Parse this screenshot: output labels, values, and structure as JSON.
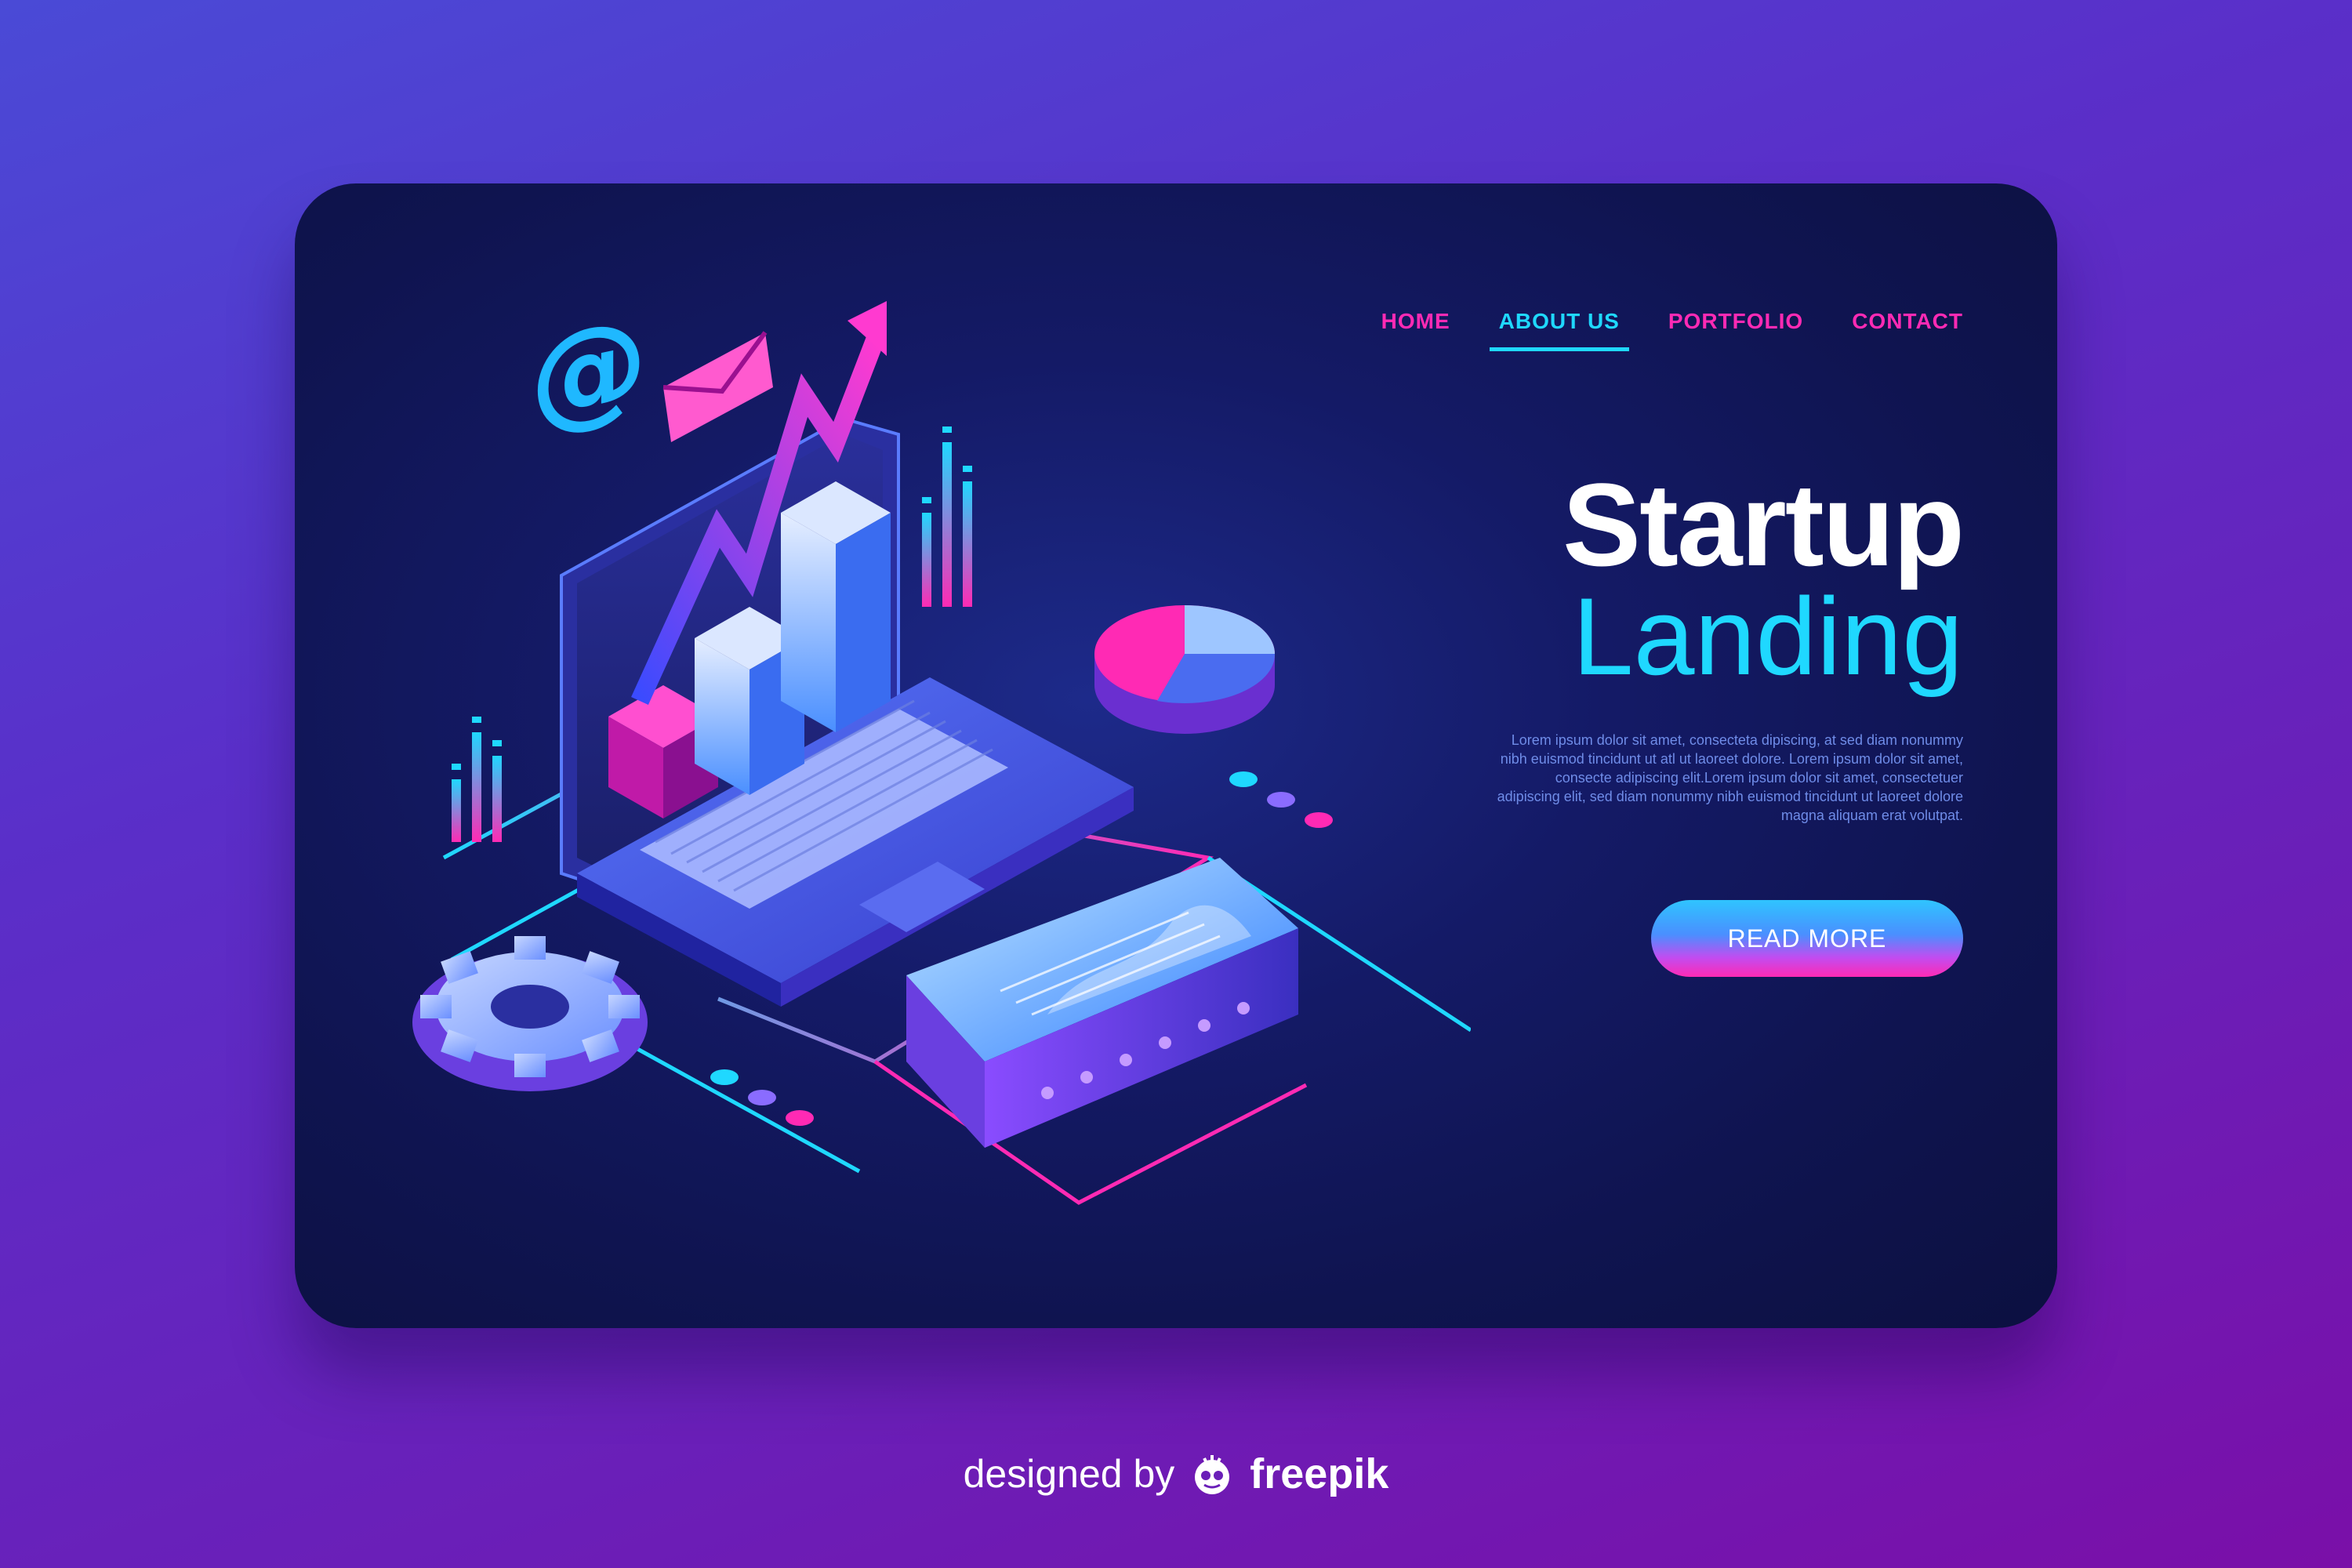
{
  "nav": {
    "items": [
      {
        "label": "HOME",
        "active": false
      },
      {
        "label": "ABOUT US",
        "active": true
      },
      {
        "label": "PORTFOLIO",
        "active": false
      },
      {
        "label": "CONTACT",
        "active": false
      }
    ]
  },
  "hero": {
    "title": "Startup",
    "subtitle": "Landing",
    "body": "Lorem ipsum dolor sit amet, consecteta dipiscing, at sed diam nonummy nibh euismod tincidunt ut atl  ut laoreet dolore. Lorem ipsum dolor sit amet, consecte adipiscing elit.Lorem ipsum dolor sit amet, consectetuer adipiscing elit, sed diam nonummy nibh euismod tincidunt ut laoreet dolore magna aliquam erat volutpat.",
    "cta_label": "READ MORE"
  },
  "credit": {
    "prefix": "designed by",
    "brand": "freepik"
  },
  "illustration": {
    "icons": [
      "at-sign-icon",
      "envelope-icon",
      "growth-arrow-icon",
      "bar-chart-icon",
      "pie-chart-icon",
      "gear-icon",
      "laptop-icon",
      "server-icon"
    ]
  },
  "colors": {
    "accent_pink": "#ff2ab4",
    "accent_cyan": "#1fd8ff",
    "card_bg": "#141a66"
  }
}
